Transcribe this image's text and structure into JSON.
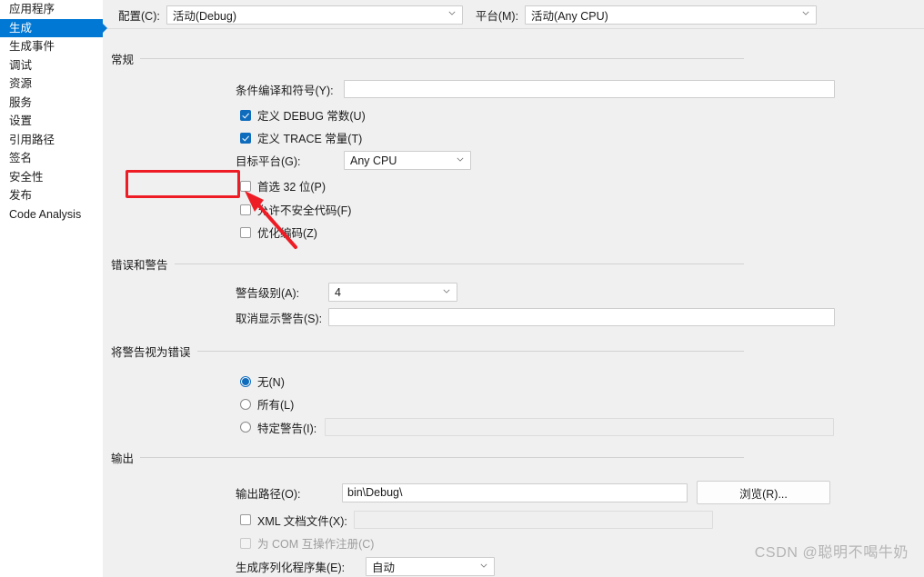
{
  "sidebar": {
    "items": [
      {
        "label": "应用程序",
        "selected": false
      },
      {
        "label": "生成",
        "selected": true
      },
      {
        "label": "生成事件",
        "selected": false
      },
      {
        "label": "调试",
        "selected": false
      },
      {
        "label": "资源",
        "selected": false
      },
      {
        "label": "服务",
        "selected": false
      },
      {
        "label": "设置",
        "selected": false
      },
      {
        "label": "引用路径",
        "selected": false
      },
      {
        "label": "签名",
        "selected": false
      },
      {
        "label": "安全性",
        "selected": false
      },
      {
        "label": "发布",
        "selected": false
      },
      {
        "label": "Code Analysis",
        "selected": false
      }
    ]
  },
  "config_bar": {
    "configuration_label": "配置(C):",
    "configuration_value": "活动(Debug)",
    "platform_label": "平台(M):",
    "platform_value": "活动(Any CPU)"
  },
  "general": {
    "title": "常规",
    "conditional_symbols_label": "条件编译和符号(Y):",
    "conditional_symbols_value": "",
    "define_debug_label": "定义 DEBUG 常数(U)",
    "define_debug_checked": true,
    "define_trace_label": "定义 TRACE 常量(T)",
    "define_trace_checked": true,
    "target_platform_label": "目标平台(G):",
    "target_platform_value": "Any CPU",
    "prefer32_label": "首选 32 位(P)",
    "prefer32_checked": false,
    "unsafe_label": "允许不安全代码(F)",
    "unsafe_checked": false,
    "optimize_label": "优化编码(Z)",
    "optimize_checked": false
  },
  "errors_warnings": {
    "title": "错误和警告",
    "warning_level_label": "警告级别(A):",
    "warning_level_value": "4",
    "suppress_warnings_label": "取消显示警告(S):",
    "suppress_warnings_value": ""
  },
  "treat_warnings": {
    "title": "将警告视为错误",
    "none_label": "无(N)",
    "none_selected": true,
    "all_label": "所有(L)",
    "all_selected": false,
    "specific_label": "特定警告(I):",
    "specific_selected": false,
    "specific_value": ""
  },
  "output": {
    "title": "输出",
    "output_path_label": "输出路径(O):",
    "output_path_value": "bin\\Debug\\",
    "browse_label": "浏览(R)...",
    "xml_doc_label": "XML 文档文件(X):",
    "xml_doc_checked": false,
    "xml_doc_value": "",
    "com_interop_label": "为 COM 互操作注册(C)",
    "com_interop_checked": false,
    "serialization_label": "生成序列化程序集(E):",
    "serialization_value": "自动"
  },
  "watermark": {
    "text": "CSDN @聪明不喝牛奶"
  },
  "colors": {
    "accent": "#0078d4",
    "checkbox": "#0f6cbd",
    "annotation": "#ee1c25"
  }
}
